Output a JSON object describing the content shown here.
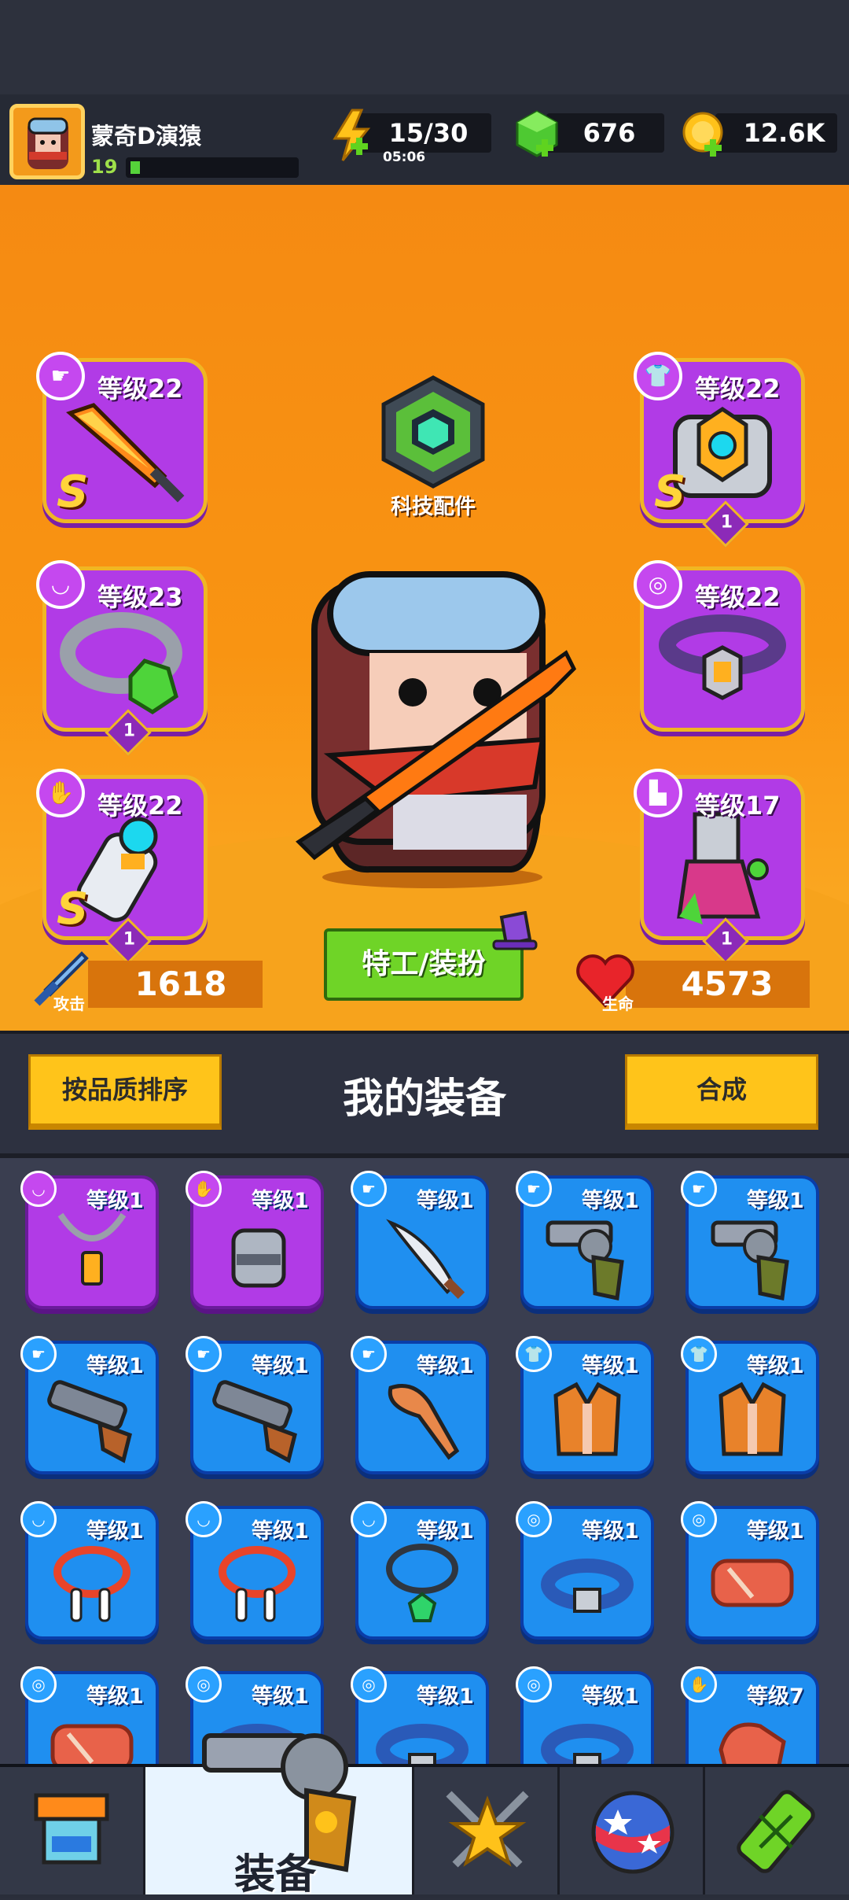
{
  "player": {
    "name": "蒙奇D演猿",
    "level": "19",
    "xp_fraction": 0.06
  },
  "resources": {
    "energy": "15/30",
    "energy_timer": "05:06",
    "gems": "676",
    "gold": "12.6K"
  },
  "tech": {
    "label": "科技配件"
  },
  "slots": {
    "weapon": {
      "level": "等级22",
      "rank": "S"
    },
    "armor": {
      "level": "等级22",
      "rank": "S",
      "count": "1"
    },
    "necklace": {
      "level": "等级23",
      "count": "1"
    },
    "belt": {
      "level": "等级22"
    },
    "gloves": {
      "level": "等级22",
      "rank": "S",
      "count": "1"
    },
    "boots": {
      "level": "等级17",
      "count": "1"
    }
  },
  "stats": {
    "attack_label": "攻击",
    "attack_value": "1618",
    "hp_label": "生命",
    "hp_value": "4573"
  },
  "agent_button": "特工/装扮",
  "inventory": {
    "sort_button": "按品质排序",
    "title": "我的装备",
    "merge_button": "合成",
    "items": [
      {
        "level": "等级1",
        "type": "necklace",
        "rarity": "purple",
        "icon": "necklace-icon"
      },
      {
        "level": "等级1",
        "type": "gloves",
        "rarity": "purple",
        "icon": "glove-icon"
      },
      {
        "level": "等级1",
        "type": "weapon",
        "rarity": "blue",
        "icon": "sword-icon"
      },
      {
        "level": "等级1",
        "type": "weapon",
        "rarity": "blue",
        "icon": "revolver-icon"
      },
      {
        "level": "等级1",
        "type": "weapon",
        "rarity": "blue",
        "icon": "revolver-icon"
      },
      {
        "level": "等级1",
        "type": "weapon",
        "rarity": "blue",
        "icon": "shotgun-icon"
      },
      {
        "level": "等级1",
        "type": "weapon",
        "rarity": "blue",
        "icon": "shotgun-icon"
      },
      {
        "level": "等级1",
        "type": "weapon",
        "rarity": "blue",
        "icon": "bat-icon"
      },
      {
        "level": "等级1",
        "type": "armor",
        "rarity": "blue",
        "icon": "jacket-icon"
      },
      {
        "level": "等级1",
        "type": "armor",
        "rarity": "blue",
        "icon": "jacket-icon"
      },
      {
        "level": "等级1",
        "type": "necklace",
        "rarity": "blue",
        "icon": "bone-necklace-icon"
      },
      {
        "level": "等级1",
        "type": "necklace",
        "rarity": "blue",
        "icon": "bone-necklace-icon"
      },
      {
        "level": "等级1",
        "type": "necklace",
        "rarity": "blue",
        "icon": "gem-necklace-icon"
      },
      {
        "level": "等级1",
        "type": "belt",
        "rarity": "blue",
        "icon": "belt-icon"
      },
      {
        "level": "等级1",
        "type": "belt",
        "rarity": "blue",
        "icon": "bandage-belt-icon"
      },
      {
        "level": "等级1",
        "type": "belt",
        "rarity": "blue",
        "icon": "bandage-belt-icon"
      },
      {
        "level": "等级1",
        "type": "belt",
        "rarity": "blue",
        "icon": "belt-icon"
      },
      {
        "level": "等级1",
        "type": "belt",
        "rarity": "blue",
        "icon": "belt-icon"
      },
      {
        "level": "等级1",
        "type": "belt",
        "rarity": "blue",
        "icon": "belt-icon"
      },
      {
        "level": "等级7",
        "type": "gloves",
        "rarity": "blue",
        "icon": "bandage-glove-icon"
      }
    ]
  },
  "nav": {
    "active_label": "装备",
    "tabs": [
      "shop-icon",
      "revolver-icon",
      "star-swords-icon",
      "star-ball-icon",
      "dna-capsule-icon"
    ]
  },
  "colors": {
    "purple_rarity": "#b13be6",
    "blue_rarity": "#1f8ff0",
    "orange_bg": "#f58a12",
    "gold_frame": "#f0b624",
    "green_button": "#6fd427",
    "yellow_button": "#ffc41a"
  }
}
